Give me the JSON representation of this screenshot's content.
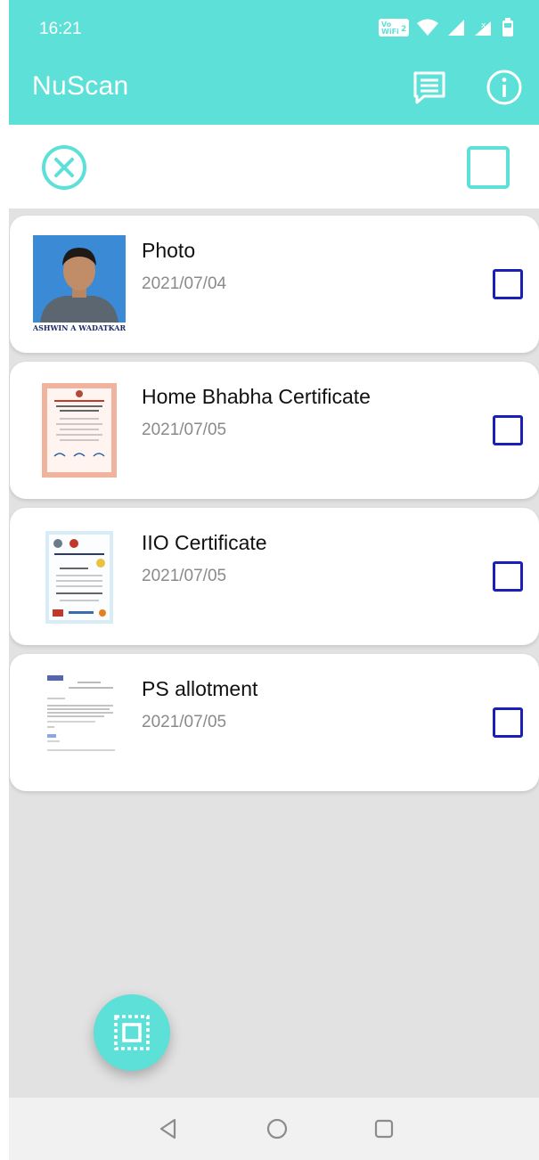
{
  "status_bar": {
    "time": "16:21",
    "volte": "Vo WiFi 2"
  },
  "app_bar": {
    "title": "NuScan",
    "feedback_icon": "message-icon",
    "info_icon": "info-icon",
    "accent": "#5ce0d8"
  },
  "toolbar": {
    "cancel_icon": "cancel-selection-icon",
    "select_all_icon": "select-all-checkbox"
  },
  "documents": [
    {
      "name": "Photo",
      "date": "2021/07/04",
      "thumbnail_caption": "ASHWIN A WADATKAR",
      "checked": false
    },
    {
      "name": "Home Bhabha Certificate",
      "date": "2021/07/05",
      "checked": false
    },
    {
      "name": "IIO Certificate",
      "date": "2021/07/05",
      "checked": false
    },
    {
      "name": "PS allotment",
      "date": "2021/07/05",
      "checked": false
    }
  ],
  "fab": {
    "icon": "scan-icon"
  },
  "nav": {
    "back": "back-icon",
    "home": "home-icon",
    "recent": "recent-apps-icon"
  }
}
